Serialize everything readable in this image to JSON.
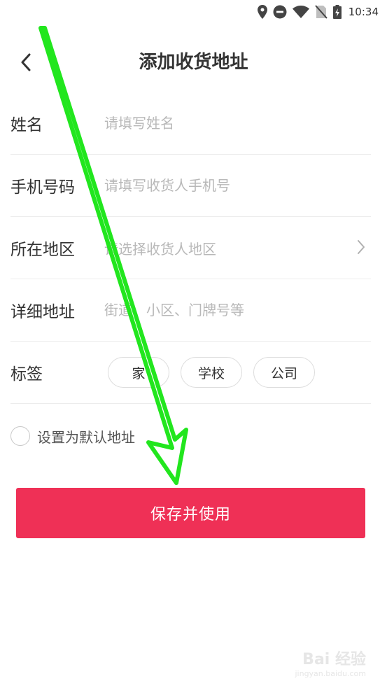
{
  "status_bar": {
    "time": "10:34",
    "icons": [
      "location-icon",
      "dnd-icon",
      "wifi-icon",
      "no-sim-icon",
      "battery-charging-icon"
    ]
  },
  "header": {
    "back_icon": "chevron-left-icon",
    "title": "添加收货地址"
  },
  "form": {
    "name": {
      "label": "姓名",
      "placeholder": "请填写姓名"
    },
    "phone": {
      "label": "手机号码",
      "placeholder": "请填写收货人手机号"
    },
    "region": {
      "label": "所在地区",
      "placeholder": "请选择收货人地区",
      "icon": "chevron-right-icon"
    },
    "detail": {
      "label": "详细地址",
      "placeholder": "街道、小区、门牌号等"
    },
    "tags": {
      "label": "标签",
      "options": [
        "家",
        "学校",
        "公司"
      ]
    }
  },
  "default_address": {
    "label": "设置为默认地址"
  },
  "save_button": {
    "label": "保存并使用"
  },
  "watermark": {
    "text": "Bai 经验",
    "sub": "jingyan.baidu.com"
  },
  "colors": {
    "accent": "#ef3056",
    "annotation": "#22e61e"
  }
}
